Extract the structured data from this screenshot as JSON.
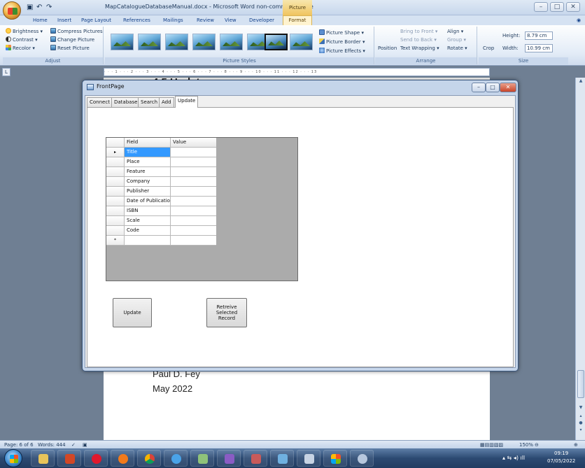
{
  "window": {
    "title": "MapCatalogueDatabaseManual.docx - Microsoft Word non-commercial use",
    "contextual_tab_group": "Picture Tools",
    "controls": {
      "minimize": "–",
      "maximize": "□",
      "close": "✕"
    }
  },
  "ribbon_tabs": [
    "Home",
    "Insert",
    "Page Layout",
    "References",
    "Mailings",
    "Review",
    "View",
    "Developer",
    "Format"
  ],
  "ribbon": {
    "adjust": {
      "brightness": "Brightness ▾",
      "compress": "Compress Pictures",
      "contrast": "Contrast ▾",
      "change": "Change Picture",
      "recolor": "Recolor ▾",
      "reset": "Reset Picture",
      "label": "Adjust"
    },
    "picture_styles": {
      "shape": "Picture Shape ▾",
      "border": "Picture Border ▾",
      "effects": "Picture Effects ▾",
      "label": "Picture Styles"
    },
    "arrange": {
      "position": "Position",
      "bring_front": "Bring to Front ▾",
      "send_back": "Send to Back ▾",
      "text_wrapping": "Text Wrapping ▾",
      "align": "Align ▾",
      "group": "Group ▾",
      "rotate": "Rotate ▾",
      "label": "Arrange"
    },
    "size": {
      "crop": "Crop",
      "height_label": "Height:",
      "height_value": "8.79 cm",
      "width_label": "Width:",
      "width_value": "10.99 cm",
      "label": "Size"
    }
  },
  "document": {
    "heading": "4.5 Update",
    "author": "Paul D. Fey",
    "date": "May 2022"
  },
  "dialog": {
    "title": "FrontPage",
    "tabs": [
      "Connect",
      "Database",
      "Search",
      "Add",
      "Update"
    ],
    "active_tab": "Update",
    "grid": {
      "headers": [
        "Field",
        "Value"
      ],
      "rows": [
        "Title",
        "Place",
        "Feature",
        "Company",
        "Publisher",
        "Date of Publication",
        "ISBN",
        "Scale",
        "Code"
      ],
      "current_row_marker": "▸",
      "new_row_marker": "*"
    },
    "buttons": {
      "update": "Update",
      "retrieve_line1": "Retreive",
      "retrieve_line2": "Selected",
      "retrieve_line3": "Record"
    }
  },
  "status_bar": {
    "page": "Page: 6 of 6",
    "words": "Words: 444",
    "zoom": "150%"
  },
  "taskbar": {
    "time": "09:19",
    "date": "07/05/2022"
  }
}
